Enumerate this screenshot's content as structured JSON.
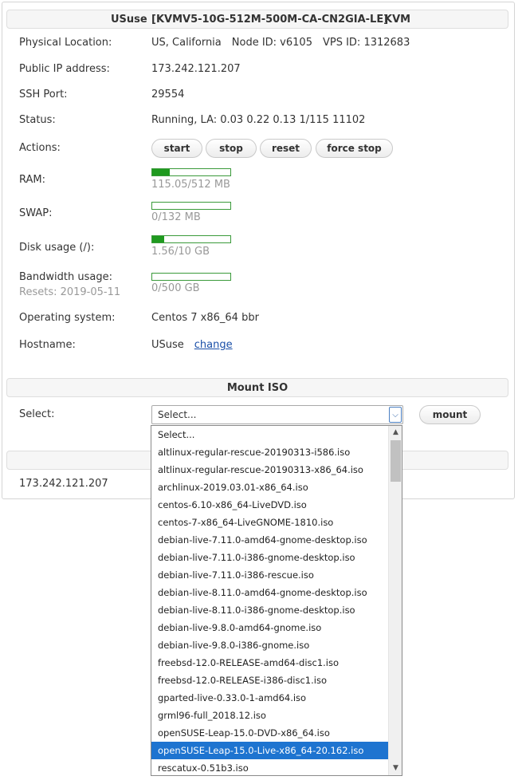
{
  "header": {
    "name": "USuse",
    "plan": "[KVMV5-10G-512M-500M-CA-CN2GIA-LE]",
    "type": "KVM"
  },
  "info": {
    "location_label": "Physical Location:",
    "location_value": "US, California",
    "node_id": "Node ID: v6105",
    "vps_id": "VPS ID: 1312683",
    "ip_label": "Public IP address:",
    "ip_value": "173.242.121.207",
    "ssh_label": "SSH Port:",
    "ssh_value": "29554",
    "status_label": "Status:",
    "status_value": "Running, LA: 0.03 0.22 0.13 1/115 11102",
    "actions_label": "Actions:",
    "actions": {
      "start": "start",
      "stop": "stop",
      "reset": "reset",
      "force_stop": "force stop"
    },
    "ram_label": "RAM:",
    "ram_text": "115.05/512 MB",
    "ram_fraction": 0.2247,
    "swap_label": "SWAP:",
    "swap_text": "0/132 MB",
    "swap_fraction": 0,
    "disk_label": "Disk usage (/):",
    "disk_text": "1.56/10 GB",
    "disk_fraction": 0.156,
    "bw_label": "Bandwidth usage:",
    "bw_resets": "Resets: 2019-05-11",
    "bw_text": "0/500 GB",
    "bw_fraction": 0,
    "os_label": "Operating system:",
    "os_value": "Centos 7 x86_64 bbr",
    "hostname_label": "Hostname:",
    "hostname_value": "USuse",
    "hostname_change": "change"
  },
  "iso": {
    "section_title": "Mount ISO",
    "select_label": "Select:",
    "selected": "Select...",
    "mount_label": "mount",
    "options": [
      "Select...",
      "altlinux-regular-rescue-20190313-i586.iso",
      "altlinux-regular-rescue-20190313-x86_64.iso",
      "archlinux-2019.03.01-x86_64.iso",
      "centos-6.10-x86_64-LiveDVD.iso",
      "centos-7-x86_64-LiveGNOME-1810.iso",
      "debian-live-7.11.0-amd64-gnome-desktop.iso",
      "debian-live-7.11.0-i386-gnome-desktop.iso",
      "debian-live-7.11.0-i386-rescue.iso",
      "debian-live-8.11.0-amd64-gnome-desktop.iso",
      "debian-live-8.11.0-i386-gnome-desktop.iso",
      "debian-live-9.8.0-amd64-gnome.iso",
      "debian-live-9.8.0-i386-gnome.iso",
      "freebsd-12.0-RELEASE-amd64-disc1.iso",
      "freebsd-12.0-RELEASE-i386-disc1.iso",
      "gparted-live-0.33.0-1-amd64.iso",
      "grml96-full_2018.12.iso",
      "openSUSE-Leap-15.0-DVD-x86_64.iso",
      "openSUSE-Leap-15.0-Live-x86_64-20.162.iso",
      "rescatux-0.51b3.iso"
    ],
    "highlighted_index": 18
  },
  "footer": {
    "ip": "173.242.121.207"
  },
  "colors": {
    "bar_fill": "#1f9a1f",
    "bar_border": "#3a9a3a",
    "highlight": "#1e74d0",
    "link": "#1a4fa8"
  }
}
